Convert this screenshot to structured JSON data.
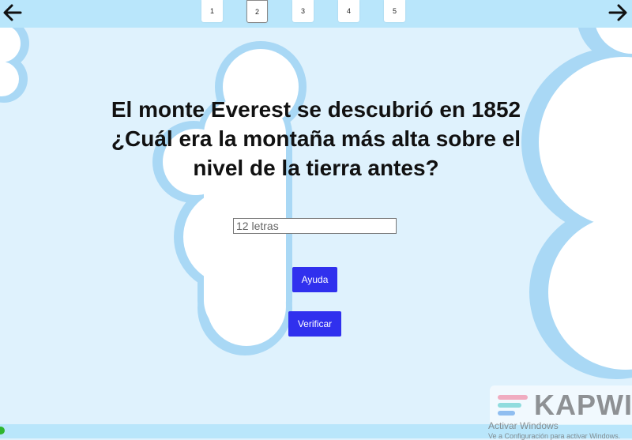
{
  "pagination": {
    "pages": [
      "1",
      "2",
      "3",
      "4",
      "5"
    ],
    "active_index": 1
  },
  "navigation": {
    "prev_icon": "arrow-left-icon",
    "next_icon": "arrow-right-icon"
  },
  "question": {
    "line1": "El monte Everest se descubrió en 1852",
    "line2": "¿Cuál era la montaña más alta sobre el",
    "line3": "nivel de la tierra antes?"
  },
  "answer": {
    "value": "",
    "placeholder": "12 letras"
  },
  "buttons": {
    "help_label": "Ayuda",
    "verify_label": "Verificar"
  },
  "branding": {
    "logo_text": "KAPWI"
  },
  "os_watermark": {
    "title": "Activar Windows",
    "subtitle": "Ve a Configuración para activar Windows."
  },
  "colors": {
    "background": "#dff2fd",
    "bar": "#b9e6fb",
    "cloud_outline": "#a9d8f5",
    "button": "#3030ee"
  }
}
